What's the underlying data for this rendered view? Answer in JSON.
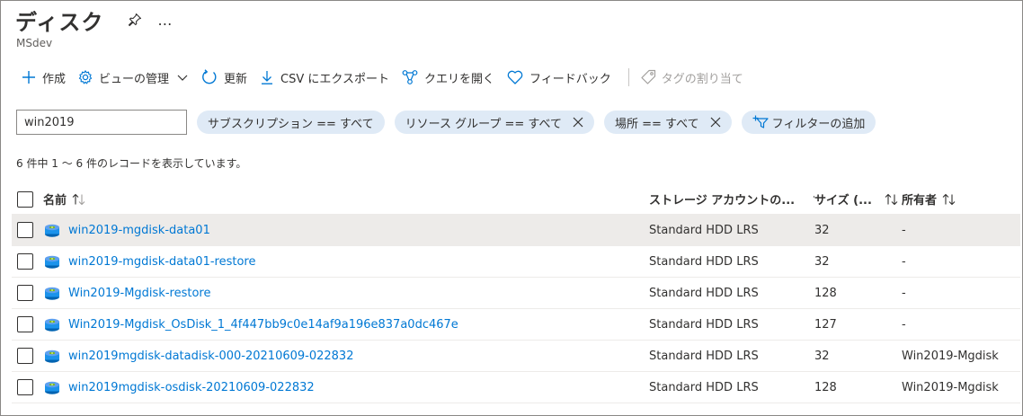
{
  "header": {
    "title": "ディスク",
    "more": "…",
    "subtitle": "MSdev"
  },
  "toolbar": {
    "create": "作成",
    "manage_view": "ビューの管理",
    "refresh": "更新",
    "export_csv": "CSV にエクスポート",
    "open_query": "クエリを開く",
    "feedback": "フィードバック",
    "assign_tags": "タグの割り当て"
  },
  "filters": {
    "search_value": "win2019",
    "subscription": "サブスクリプション == すべて",
    "resource_group": "リソース グループ == すべて",
    "location": "場所 == すべて",
    "add_filter": "フィルターの追加"
  },
  "record_count": "6 件中 1 ～ 6 件のレコードを表示しています。",
  "columns": {
    "name": "名前",
    "storage": "ストレージ アカウントの...",
    "size": "サイズ (...",
    "owner": "所有者"
  },
  "rows": [
    {
      "name": "win2019-mgdisk-data01",
      "storage": "Standard HDD LRS",
      "size": "32",
      "owner": "-"
    },
    {
      "name": "win2019-mgdisk-data01-restore",
      "storage": "Standard HDD LRS",
      "size": "32",
      "owner": "-"
    },
    {
      "name": "Win2019-Mgdisk-restore",
      "storage": "Standard HDD LRS",
      "size": "128",
      "owner": "-"
    },
    {
      "name": "Win2019-Mgdisk_OsDisk_1_4f447bb9c0e14af9a196e837a0dc467e",
      "storage": "Standard HDD LRS",
      "size": "127",
      "owner": "-"
    },
    {
      "name": "win2019mgdisk-datadisk-000-20210609-022832",
      "storage": "Standard HDD LRS",
      "size": "32",
      "owner": "Win2019-Mgdisk"
    },
    {
      "name": "win2019mgdisk-osdisk-20210609-022832",
      "storage": "Standard HDD LRS",
      "size": "128",
      "owner": "Win2019-Mgdisk"
    }
  ],
  "colors": {
    "link": "#0078d4",
    "pill_bg": "#dfeaf6",
    "row_selected": "#edebe9"
  }
}
